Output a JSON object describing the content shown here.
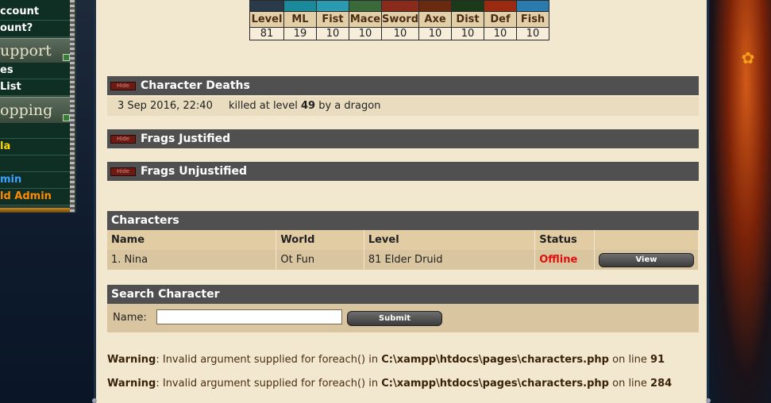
{
  "menu": {
    "items_top": [
      "ccount",
      "ount?"
    ],
    "support_header": "upport",
    "support_items": [
      "es",
      "List"
    ],
    "shopping_header": "opping",
    "shopping_items": [
      {
        "label": "la",
        "color": "#ffd800"
      },
      {
        "label": "",
        "color": "#ffffff"
      },
      {
        "label": "min",
        "color": "#3aa0ff"
      },
      {
        "label": "ld Admin",
        "color": "#ff8a00"
      }
    ]
  },
  "skills": {
    "labels": [
      "Level",
      "ML",
      "Fist",
      "Mace",
      "Sword",
      "Axe",
      "Dist",
      "Def",
      "Fish"
    ],
    "values": [
      "81",
      "19",
      "10",
      "10",
      "10",
      "10",
      "10",
      "10",
      "10"
    ]
  },
  "deaths": {
    "hide_label": "Hide",
    "title": "Character Deaths",
    "date": "3 Sep 2016, 22:40",
    "text_before": "killed at level",
    "level": "49",
    "text_after": "by a dragon"
  },
  "frags_justified": {
    "hide_label": "Hide",
    "title": "Frags Justified"
  },
  "frags_unjustified": {
    "hide_label": "Hide",
    "title": "Frags Unjustified"
  },
  "characters": {
    "title": "Characters",
    "headers": [
      "Name",
      "World",
      "Level",
      "Status",
      ""
    ],
    "rows": [
      {
        "name": "1. Nina",
        "world": "Ot Fun",
        "level": "81 Elder Druid",
        "status": "Offline",
        "action": "View"
      }
    ]
  },
  "search": {
    "title": "Search Character",
    "label": "Name:",
    "value": "",
    "submit": "Submit"
  },
  "warnings": [
    {
      "prefix": "Warning",
      "message": ": Invalid argument supplied for foreach() in ",
      "path": "C:\\xampp\\htdocs\\pages\\characters.php",
      "line_text": " on line ",
      "line": "91"
    },
    {
      "prefix": "Warning",
      "message": ": Invalid argument supplied for foreach() in ",
      "path": "C:\\xampp\\htdocs\\pages\\characters.php",
      "line_text": " on line ",
      "line": "284"
    }
  ],
  "colors": {
    "panel": "#f2e8cf",
    "section_header": "#505050",
    "offline": "#e01010"
  }
}
